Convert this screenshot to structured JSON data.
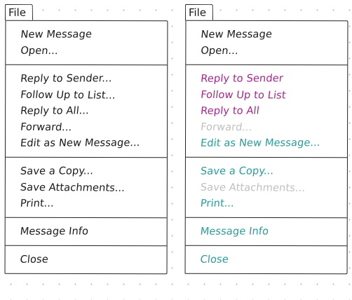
{
  "colors": {
    "ink": "#1a1a1a",
    "magenta": "#a6278c",
    "teal": "#2a9d9a",
    "disabled": "#c0c0c0"
  },
  "menus": [
    {
      "title": "File",
      "groups": [
        [
          {
            "label": "New Message",
            "color": "ink"
          },
          {
            "label": "Open...",
            "color": "ink"
          }
        ],
        [
          {
            "label": "Reply to Sender...",
            "color": "ink"
          },
          {
            "label": "Follow Up to List...",
            "color": "ink"
          },
          {
            "label": "Reply to All...",
            "color": "ink"
          },
          {
            "label": "Forward...",
            "color": "ink"
          },
          {
            "label": "Edit as New Message...",
            "color": "ink"
          }
        ],
        [
          {
            "label": "Save a Copy...",
            "color": "ink"
          },
          {
            "label": "Save Attachments...",
            "color": "ink"
          },
          {
            "label": "Print...",
            "color": "ink"
          }
        ],
        [
          {
            "label": "Message Info",
            "color": "ink"
          }
        ],
        [
          {
            "label": "Close",
            "color": "ink"
          }
        ]
      ]
    },
    {
      "title": "File",
      "groups": [
        [
          {
            "label": "New Message",
            "color": "ink"
          },
          {
            "label": "Open...",
            "color": "ink"
          }
        ],
        [
          {
            "label": "Reply to Sender",
            "color": "magenta"
          },
          {
            "label": "Follow Up to List",
            "color": "magenta"
          },
          {
            "label": "Reply to All",
            "color": "magenta"
          },
          {
            "label": "Forward...",
            "color": "disabled"
          },
          {
            "label": "Edit as New Message...",
            "color": "teal"
          }
        ],
        [
          {
            "label": "Save a Copy...",
            "color": "teal"
          },
          {
            "label": "Save Attachments...",
            "color": "disabled"
          },
          {
            "label": "Print...",
            "color": "teal"
          }
        ],
        [
          {
            "label": "Message Info",
            "color": "teal"
          }
        ],
        [
          {
            "label": "Close",
            "color": "teal"
          }
        ]
      ]
    }
  ]
}
